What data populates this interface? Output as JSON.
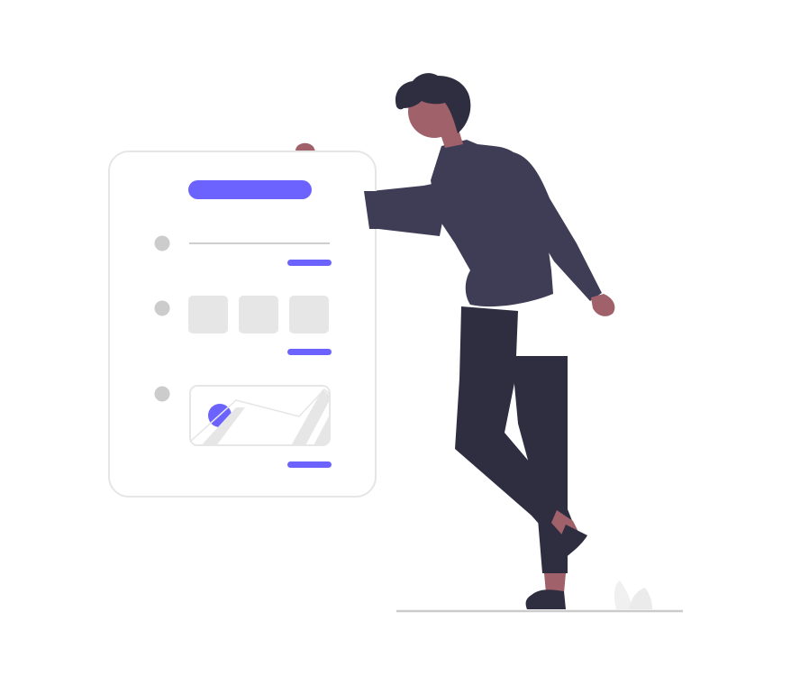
{
  "colors": {
    "accent": "#6c63ff",
    "card_border": "#e6e6e6",
    "card_fill": "#ffffff",
    "placeholder_gray": "#e6e6e6",
    "dot_gray": "#cccccc",
    "line_gray": "#cfcfcf",
    "sweater": "#3f3d56",
    "pants": "#2f2e41",
    "hair": "#2f2e41",
    "skin": "#a0616a",
    "ground": "#cbcbcb",
    "plant": "#f0f0f0"
  },
  "illustration": {
    "card_sections": [
      "text-line",
      "image-tiles",
      "image-frame"
    ],
    "figure": "person-holding-form-card"
  }
}
